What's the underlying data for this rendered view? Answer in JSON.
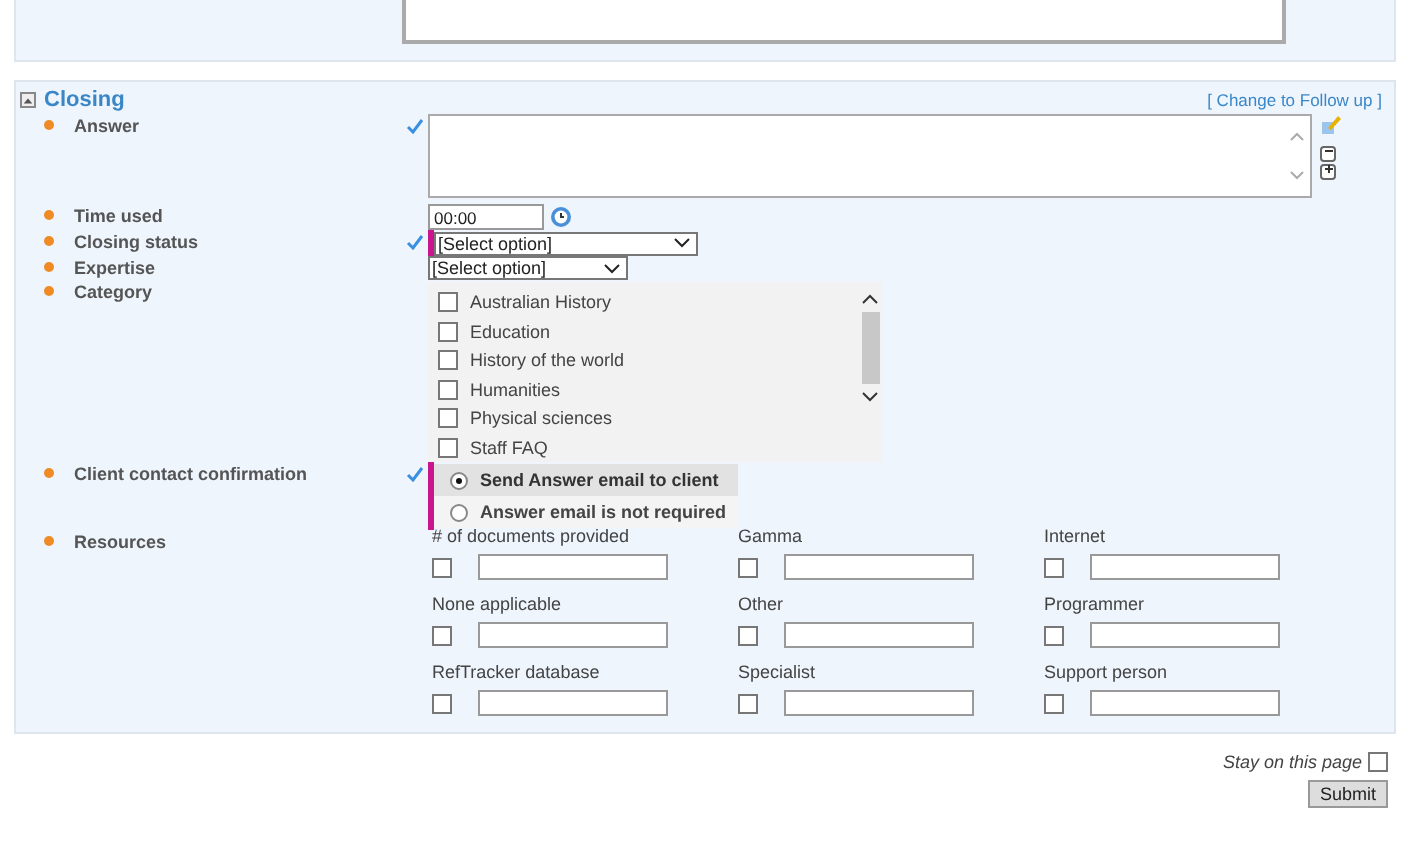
{
  "section": {
    "title": "Closing",
    "expanded": true,
    "action_link": "[ Change to Follow up ]"
  },
  "fields": [
    {
      "kind": "textarea",
      "label": "Answer",
      "validated": true,
      "flagged": false
    },
    {
      "kind": "time",
      "label": "Time used",
      "validated": false,
      "flagged": false,
      "value": "00:00"
    },
    {
      "kind": "select",
      "label": "Closing status",
      "validated": true,
      "flagged": true,
      "value": "[Select option]"
    },
    {
      "kind": "select",
      "label": "Expertise",
      "validated": false,
      "flagged": false,
      "value": "[Select option]"
    },
    {
      "kind": "checklist",
      "label": "Category",
      "validated": false,
      "flagged": false,
      "options": [
        {
          "label": "Australian History",
          "checked": false
        },
        {
          "label": "Education",
          "checked": false
        },
        {
          "label": "History of the world",
          "checked": false
        },
        {
          "label": "Humanities",
          "checked": false
        },
        {
          "label": "Physical sciences",
          "checked": false
        },
        {
          "label": "Staff FAQ",
          "checked": false
        }
      ]
    },
    {
      "kind": "radio",
      "label": "Client contact confirmation",
      "validated": true,
      "flagged": true,
      "options": [
        {
          "label": "Send Answer email to client",
          "selected": true
        },
        {
          "label": "Answer email is not required",
          "selected": false
        }
      ]
    },
    {
      "kind": "resources",
      "label": "Resources",
      "validated": false,
      "flagged": false,
      "options": [
        {
          "label": "# of documents provided",
          "checked": false
        },
        {
          "label": "Gamma",
          "checked": false
        },
        {
          "label": "Internet",
          "checked": false
        },
        {
          "label": "None applicable",
          "checked": false
        },
        {
          "label": "Other",
          "checked": false
        },
        {
          "label": "Programmer",
          "checked": false
        },
        {
          "label": "RefTracker database",
          "checked": false
        },
        {
          "label": "Specialist",
          "checked": false
        },
        {
          "label": "Support person",
          "checked": false
        }
      ]
    }
  ],
  "footer": {
    "stay_label": "Stay on this page",
    "stay_checked": false,
    "submit": "Submit"
  }
}
